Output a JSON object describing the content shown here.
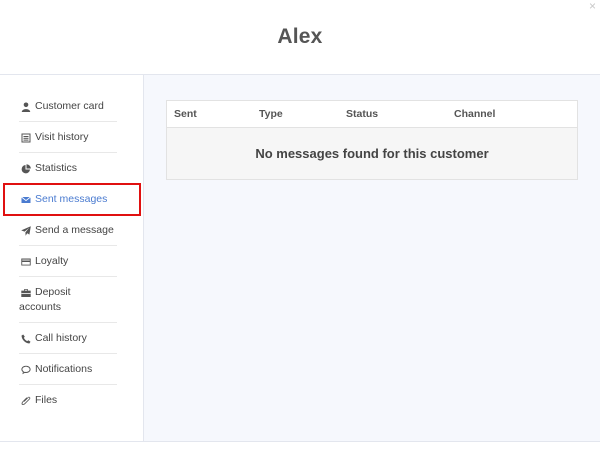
{
  "window": {
    "close_glyph": "×"
  },
  "header": {
    "title": "Alex"
  },
  "sidebar": {
    "items": [
      {
        "label": "Customer card",
        "icon": "user-icon"
      },
      {
        "label": "Visit history",
        "icon": "list-icon"
      },
      {
        "label": "Statistics",
        "icon": "pie-chart-icon"
      },
      {
        "label": "Sent messages",
        "icon": "envelope-icon",
        "active": true
      },
      {
        "label": "Send a message",
        "icon": "paper-plane-icon"
      },
      {
        "label": "Loyalty",
        "icon": "credit-card-icon"
      },
      {
        "label": "Deposit",
        "label_line2": "accounts",
        "icon": "briefcase-icon"
      },
      {
        "label": "Call history",
        "icon": "phone-icon"
      },
      {
        "label": "Notifications",
        "icon": "chat-bubble-icon"
      },
      {
        "label": "Files",
        "icon": "paperclip-icon"
      }
    ]
  },
  "main": {
    "table": {
      "columns": [
        "Sent",
        "Type",
        "Status",
        "Channel"
      ],
      "empty_message": "No messages found for this customer"
    }
  },
  "colors": {
    "accent": "#4a7bd0",
    "highlight_box": "#e01010",
    "main_bg": "#f6f8fd"
  }
}
